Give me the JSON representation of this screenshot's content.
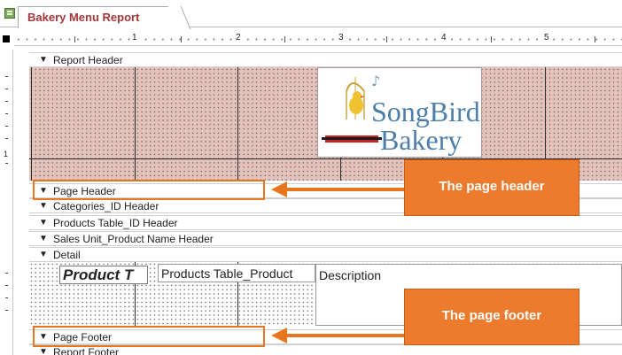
{
  "window": {
    "tab_title": "Bakery Menu Report"
  },
  "ruler": {
    "labels": [
      "1",
      "2",
      "3",
      "4",
      "5"
    ]
  },
  "vertical_ruler": {
    "label": "1"
  },
  "bands": {
    "report_header": "Report Header",
    "page_header": "Page Header",
    "categories_id_header": "Categories_ID Header",
    "products_table_id_header": "Products Table_ID Header",
    "sales_unit_header": "Sales Unit_Product Name Header",
    "detail": "Detail",
    "page_footer": "Page Footer",
    "report_footer": "Report Footer"
  },
  "detail_fields": {
    "product_title": "Product T",
    "products_table_product": "Products Table_Product",
    "description": "Description"
  },
  "logo": {
    "line1": "SongBird",
    "line2": "Bakery"
  },
  "callouts": {
    "page_header": "The page header",
    "page_footer": "The page footer"
  },
  "colors": {
    "accent": "#ec7b2d",
    "section_fill": "#e3c2bc",
    "logo_blue": "#4d7eaa",
    "title_red": "#a4373a"
  }
}
